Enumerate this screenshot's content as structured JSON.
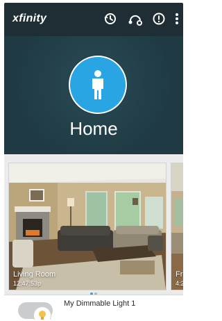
{
  "app": {
    "brand": "xfinity"
  },
  "toolbar": {
    "icons": [
      "history-icon",
      "scenes-icon",
      "alert-icon",
      "more-vert-icon"
    ]
  },
  "hero": {
    "title": "Home",
    "accent_color": "#2aa5e3"
  },
  "cameras": [
    {
      "label": "Living Room",
      "time": "12:47:53p"
    },
    {
      "label": "Fr",
      "time": "4:2"
    }
  ],
  "pager": {
    "active_index": 0,
    "count": 2
  },
  "devices": [
    {
      "label": "My Dimmable Light 1",
      "icon": "bulb-icon"
    }
  ]
}
